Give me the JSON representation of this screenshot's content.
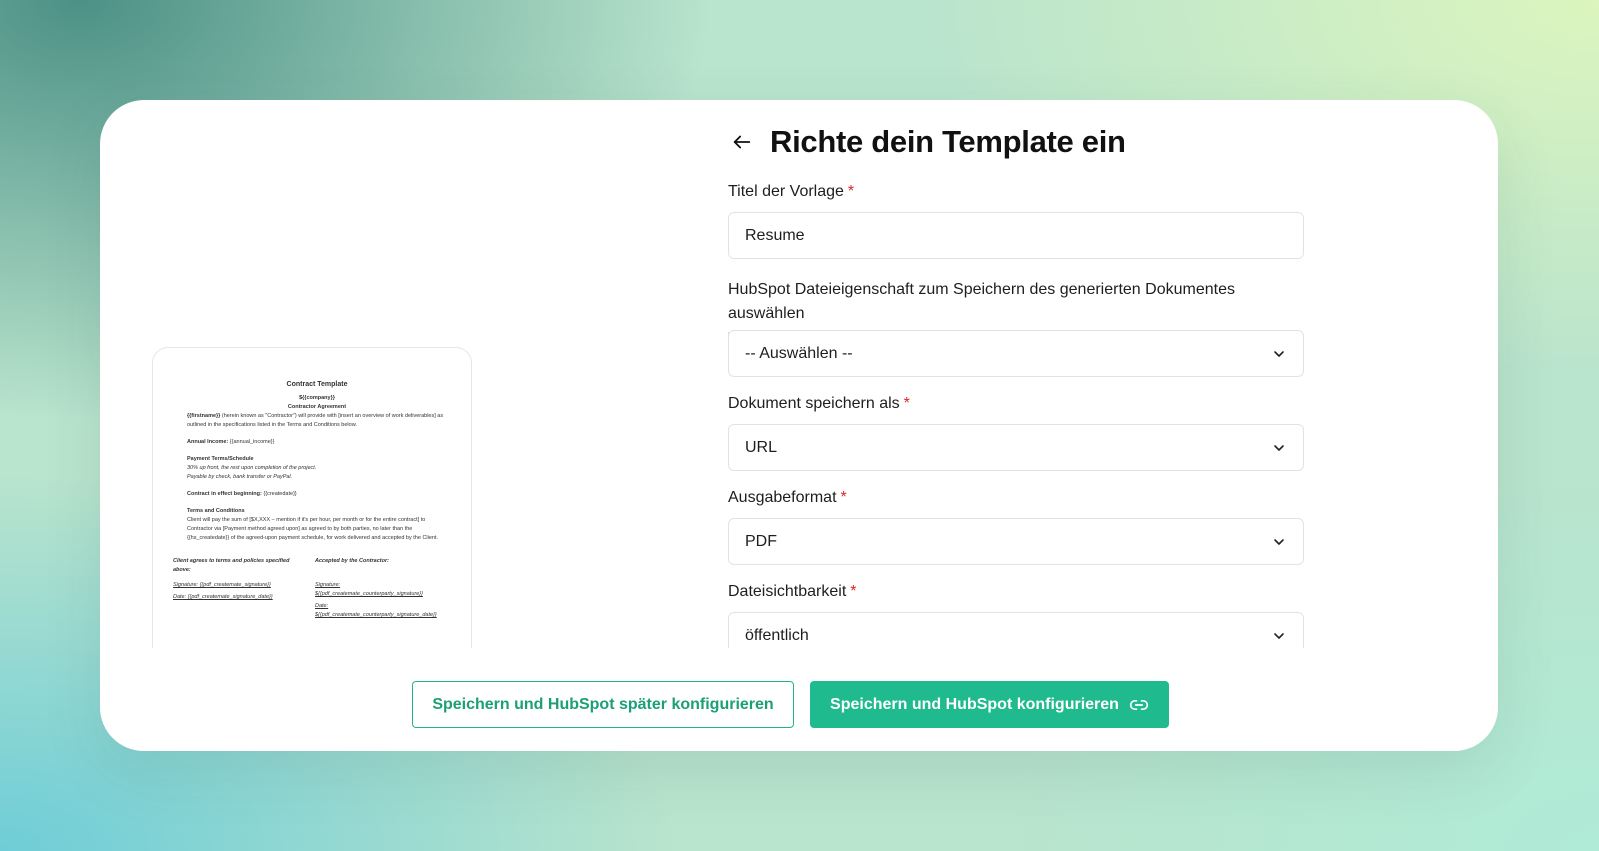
{
  "page": {
    "title": "Richte dein Template ein"
  },
  "preview": {
    "doc_title": "Contract Template",
    "company": "${{company}}",
    "agreement": "Contractor Agreement",
    "intro_bold": "{{firstname}}",
    "intro_text": " (herein known as \"Contractor\") will provide with [insert an overview of work deliverables] as outlined in the specifications listed in the Terms and Conditions below.",
    "income_label": "Annual Income:",
    "income_value": " {{annual_income}}",
    "payment_heading": "Payment Terms/Schedule",
    "payment_line1": "30% up front, the rest upon completion of the project.",
    "payment_line2": "Payable by check, bank transfer or PayPal.",
    "effect_label": "Contract in effect beginning:",
    "effect_value": " {{createdate}}",
    "terms_heading": "Terms and Conditions",
    "terms_text": "Client will pay the sum of [$X,XXX – mention if it's per hour, per month or for the entire contract] to Contractor via [Payment method agreed upon] as agreed to by both parties, no later than the {{hs_createdate}} of the agreed-upon payment schedule, for work delivered and accepted by the Client.",
    "client_heading": "Client agrees to terms and policies specified above:",
    "client_signature": "Signature: {{pdf_createmate_signature}}",
    "client_date": "Date: {{pdf_createmate_signature_date}}",
    "contractor_heading": "Accepted by the Contractor:",
    "contractor_signature": "Signature: ${{pdf_createmate_counterparty_signature}}",
    "contractor_date": "Date: ${{pdf_createmate_counterparty_signature_date}}"
  },
  "form": {
    "title_label": "Titel der Vorlage",
    "title_value": "Resume",
    "property_label": "HubSpot Dateieigenschaft zum Speichern des generierten Dokumentes auswählen",
    "property_value": "-- Auswählen --",
    "save_as_label": "Dokument speichern als",
    "save_as_value": "URL",
    "format_label": "Ausgabeformat",
    "format_value": "PDF",
    "visibility_label": "Dateisichtbarkeit",
    "visibility_value": "öffentlich",
    "required_mark": "*"
  },
  "actions": {
    "later_label": "Speichern und HubSpot später konfigurieren",
    "configure_label": "Speichern und HubSpot konfigurieren"
  },
  "icons": {
    "back": "arrow-left-icon",
    "info": "info-icon",
    "chevron": "chevron-down-icon",
    "link": "link-icon"
  },
  "colors": {
    "accent": "#1fba8d",
    "required": "#e02424"
  }
}
